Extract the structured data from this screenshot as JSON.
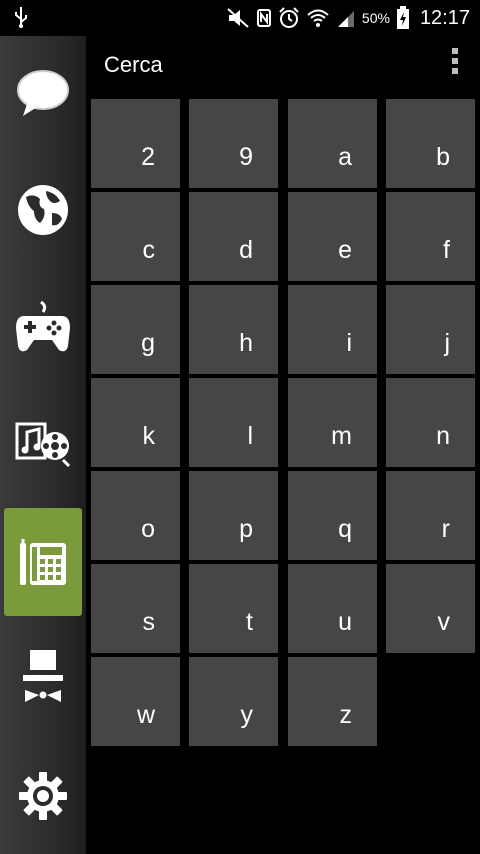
{
  "status_bar": {
    "time": "12:17",
    "battery": "50%"
  },
  "header": {
    "title": "Cerca"
  },
  "sidebar": {
    "items": [
      {
        "icon": "chat-bubble-icon"
      },
      {
        "icon": "globe-icon"
      },
      {
        "icon": "gamepad-icon"
      },
      {
        "icon": "music-video-icon"
      },
      {
        "icon": "phone-contacts-icon",
        "active": true
      },
      {
        "icon": "top-hat-icon"
      },
      {
        "icon": "gear-icon"
      }
    ]
  },
  "keys": [
    "2",
    "9",
    "a",
    "b",
    "c",
    "d",
    "e",
    "f",
    "g",
    "h",
    "i",
    "j",
    "k",
    "l",
    "m",
    "n",
    "o",
    "p",
    "q",
    "r",
    "s",
    "t",
    "u",
    "v",
    "w",
    "y",
    "z"
  ],
  "colors": {
    "accent": "#7a9a3c",
    "tile": "#464646",
    "background": "#000000"
  }
}
